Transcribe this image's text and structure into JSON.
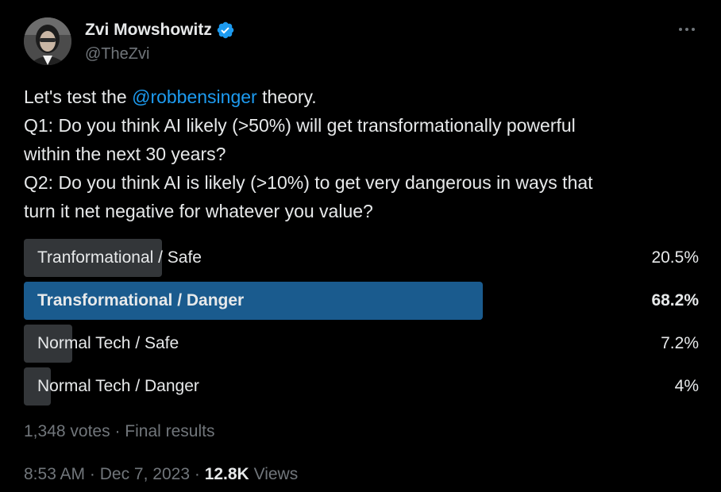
{
  "author": {
    "display_name": "Zvi Mowshowitz",
    "handle": "@TheZvi",
    "verified": true,
    "avatar": "person-photo"
  },
  "tweet": {
    "text_lines": [
      {
        "before": "Let's test the ",
        "mention": "@robbensinger",
        "after": " theory."
      },
      {
        "text": "Q1: Do you think AI likely (>50%) will get transformationally powerful"
      },
      {
        "text": "within the next 30 years?"
      },
      {
        "text": "Q2: Do you think AI is likely (>10%) to get very dangerous in ways that"
      },
      {
        "text": "turn it net negative for whatever you value?"
      }
    ]
  },
  "poll": {
    "options": [
      {
        "label": "Tranformational / Safe",
        "percent_text": "20.5%",
        "percent": 20.5,
        "winner": false
      },
      {
        "label": "Transformational / Danger",
        "percent_text": "68.2%",
        "percent": 68.2,
        "winner": true
      },
      {
        "label": "Normal Tech / Safe",
        "percent_text": "7.2%",
        "percent": 7.2,
        "winner": false
      },
      {
        "label": "Normal Tech / Danger",
        "percent_text": "4%",
        "percent": 4,
        "winner": false
      }
    ],
    "votes": "1,348 votes",
    "separator": "·",
    "status": "Final results"
  },
  "footer": {
    "time": "8:53 AM",
    "date": "Dec 7, 2023",
    "separator": "·",
    "views_count": "12.8K",
    "views_label": "Views"
  },
  "colors": {
    "background": "#000000",
    "text": "#e7e9ea",
    "muted": "#71767b",
    "accent": "#1d9bf0",
    "bar": "#333639",
    "winner_bar": "#1a5b8e"
  },
  "icons": {
    "verified": "verified-badge-icon",
    "more": "more-dots-icon"
  }
}
